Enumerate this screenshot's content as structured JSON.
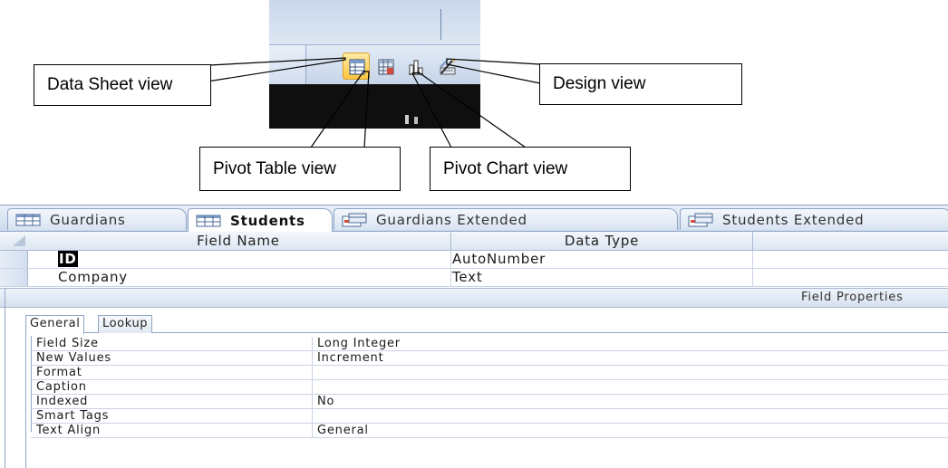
{
  "callouts": {
    "datasheet": "Data Sheet view",
    "design": "Design view",
    "pivot_table": "Pivot Table view",
    "pivot_chart": "Pivot Chart view"
  },
  "tabs": [
    {
      "label": "Guardians",
      "icon": "table-icon"
    },
    {
      "label": "Students",
      "icon": "table-icon",
      "active": true
    },
    {
      "label": "Guardians Extended",
      "icon": "query-icon"
    },
    {
      "label": "Students Extended",
      "icon": "query-icon"
    }
  ],
  "grid": {
    "header_field_name": "Field Name",
    "header_data_type": "Data Type",
    "rows": [
      {
        "field": "ID",
        "type": "AutoNumber",
        "highlighted": true
      },
      {
        "field": "Company",
        "type": "Text"
      }
    ]
  },
  "field_properties": {
    "title": "Field Properties",
    "tabs": [
      "General",
      "Lookup"
    ],
    "rows": [
      {
        "label": "Field Size",
        "value": "Long Integer"
      },
      {
        "label": "New Values",
        "value": "Increment"
      },
      {
        "label": "Format",
        "value": ""
      },
      {
        "label": "Caption",
        "value": ""
      },
      {
        "label": "Indexed",
        "value": "No"
      },
      {
        "label": "Smart Tags",
        "value": ""
      },
      {
        "label": "Text Align",
        "value": "General"
      }
    ]
  },
  "colors": {
    "active_view_button": "#ffc63d",
    "ribbon_blue": "#c9d7ea"
  }
}
